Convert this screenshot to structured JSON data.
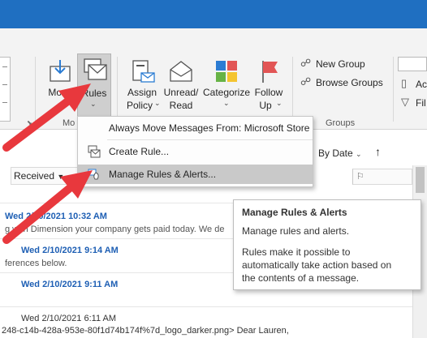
{
  "ribbon": {
    "move_label": "Move",
    "rules_label": "Rules",
    "assign_policy": [
      "Assign",
      "Policy"
    ],
    "unread_read": [
      "Unread/",
      "Read"
    ],
    "categorize_label": "Categorize",
    "follow_up": [
      "Follow",
      "Up"
    ],
    "move_group_label": "Mo",
    "new_group": "New Group",
    "browse_groups": "Browse Groups",
    "groups_label": "Groups",
    "right_cut_1": "Ac",
    "right_cut_2": "Fil"
  },
  "dropdown": {
    "header": "Always Move Messages From: Microsoft Store",
    "create_rule": "Create Rule...",
    "manage_rules": "Manage Rules & Alerts..."
  },
  "tooltip": {
    "title": "Manage Rules & Alerts",
    "subtitle": "Manage rules and alerts.",
    "body_lines": [
      "Rules make it possible to",
      "automatically take action based on",
      "the contents of a message."
    ]
  },
  "list": {
    "sort_label": "By Date",
    "received_header": "Received",
    "rows": [
      {
        "date": "Wed 2/10/2021 10:32 AM",
        "preview": "g with Dimension your company gets paid today. We de"
      },
      {
        "date": "Wed 2/10/2021 9:14 AM",
        "preview": "ferences below."
      },
      {
        "date": "Wed 2/10/2021 9:11 AM",
        "preview": ""
      },
      {
        "date": "Wed 2/10/2021 6:11 AM",
        "preview": "248-c14b-428a-953e-80f1d74b174f%7d_logo_darker.png>  Dear Lauren,"
      }
    ]
  },
  "colors": {
    "title_bar": "#1f6fc1",
    "arrow_red": "#e8383d",
    "date_blue": "#1e5fb4"
  }
}
